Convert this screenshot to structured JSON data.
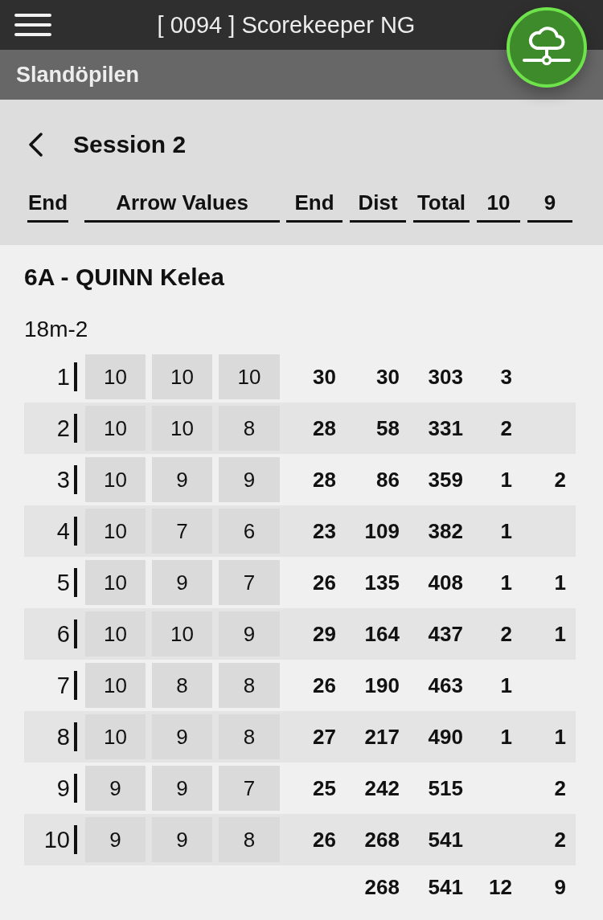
{
  "app_bar": {
    "title": "[ 0094 ] Scorekeeper NG"
  },
  "subheader": {
    "title": "Slandöpilen"
  },
  "session": {
    "title": "Session 2"
  },
  "columns": [
    "End",
    "Arrow Values",
    "End",
    "Dist",
    "Total",
    "10",
    "9"
  ],
  "archer": {
    "name": "6A - QUINN Kelea"
  },
  "distance": {
    "label": "18m-2"
  },
  "rows": [
    {
      "end": "1",
      "arrows": [
        "10",
        "10",
        "10"
      ],
      "end_total": "30",
      "dist": "30",
      "total": "303",
      "count_10": "3"
    },
    {
      "end": "2",
      "arrows": [
        "10",
        "10",
        "8"
      ],
      "end_total": "28",
      "dist": "58",
      "total": "331",
      "count_10": "2"
    },
    {
      "end": "3",
      "arrows": [
        "10",
        "9",
        "9"
      ],
      "end_total": "28",
      "dist": "86",
      "total": "359",
      "count_10": "1",
      "count_9": "2"
    },
    {
      "end": "4",
      "arrows": [
        "10",
        "7",
        "6"
      ],
      "end_total": "23",
      "dist": "109",
      "total": "382",
      "count_10": "1"
    },
    {
      "end": "5",
      "arrows": [
        "10",
        "9",
        "7"
      ],
      "end_total": "26",
      "dist": "135",
      "total": "408",
      "count_10": "1",
      "count_9": "1"
    },
    {
      "end": "6",
      "arrows": [
        "10",
        "10",
        "9"
      ],
      "end_total": "29",
      "dist": "164",
      "total": "437",
      "count_10": "2",
      "count_9": "1"
    },
    {
      "end": "7",
      "arrows": [
        "10",
        "8",
        "8"
      ],
      "end_total": "26",
      "dist": "190",
      "total": "463",
      "count_10": "1"
    },
    {
      "end": "8",
      "arrows": [
        "10",
        "9",
        "8"
      ],
      "end_total": "27",
      "dist": "217",
      "total": "490",
      "count_10": "1",
      "count_9": "1"
    },
    {
      "end": "9",
      "arrows": [
        "9",
        "9",
        "7"
      ],
      "end_total": "25",
      "dist": "242",
      "total": "515",
      "count_9": "2"
    },
    {
      "end": "10",
      "arrows": [
        "9",
        "9",
        "8"
      ],
      "end_total": "26",
      "dist": "268",
      "total": "541",
      "count_9": "2"
    }
  ],
  "totals": {
    "dist": "268",
    "total": "541",
    "count_10": "12",
    "count_9": "9"
  }
}
